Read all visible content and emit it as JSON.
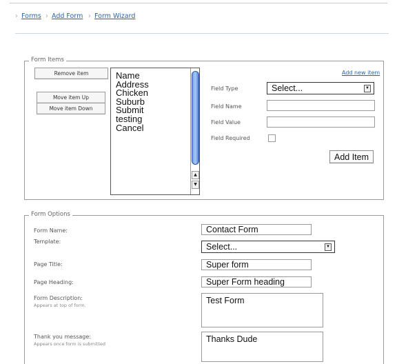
{
  "breadcrumb": {
    "separator": "›",
    "items": [
      "Forms",
      "Add Form",
      "Form Wizard"
    ]
  },
  "form_items": {
    "legend": "Form Items",
    "buttons": {
      "remove": "Remove item",
      "move_up": "Move item Up",
      "move_down": "Move item Down"
    },
    "list_items": [
      "Name",
      "Address",
      "Chicken",
      "Suburb",
      "Submit",
      "testing",
      "Cancel"
    ],
    "add_new_link": "Add new item",
    "field_type_label": "Field Type",
    "field_type_value": "Select...",
    "field_name_label": "Field Name",
    "field_name_value": "",
    "field_value_label": "Field Value",
    "field_value_value": "",
    "field_required_label": "Field Required",
    "field_required_checked": false,
    "add_item_button": "Add Item"
  },
  "form_options": {
    "legend": "Form Options",
    "form_name_label": "Form Name:",
    "form_name_value": "Contact Form",
    "template_label": "Template:",
    "template_value": "Select...",
    "page_title_label": "Page Title:",
    "page_title_value": "Super form",
    "page_heading_label": "Page Heading:",
    "page_heading_value": "Super Form heading",
    "description_label": "Form Description:",
    "description_hint": "Appears at top of form.",
    "description_value": "Test Form",
    "thankyou_label": "Thank you message:",
    "thankyou_hint": "Appears once form is submitted",
    "thankyou_value": "Thanks Dude"
  },
  "colors": {
    "link": "#2c63a8",
    "scrollbar_thumb": "#6b9fe8",
    "border": "#9a9a9a"
  }
}
